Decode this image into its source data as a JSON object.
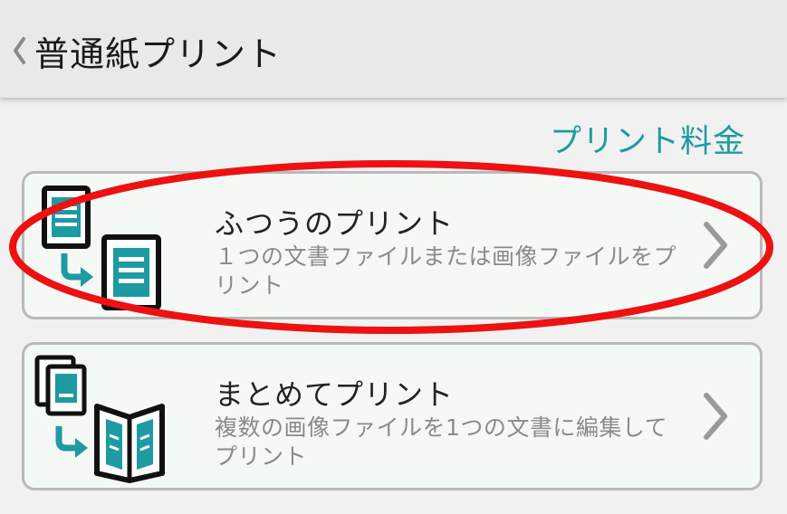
{
  "header": {
    "back_icon": "chevron-left-icon",
    "title": "普通紙プリント"
  },
  "price_link": "プリント料金",
  "options": [
    {
      "title": "ふつうのプリント",
      "description": "１つの文書ファイルまたは画像ファイルをプリント",
      "icon": "single-document-print-icon",
      "chevron": "chevron-right-icon"
    },
    {
      "title": "まとめてプリント",
      "description": "複数の画像ファイルを1つの文書に編集してプリント",
      "icon": "combine-images-print-icon",
      "chevron": "chevron-right-icon"
    }
  ],
  "colors": {
    "accent_teal": "#1e9aa3",
    "highlight_red": "#ee1111",
    "card_border": "#b9b9b9",
    "header_bg": "#e9e9e9"
  }
}
